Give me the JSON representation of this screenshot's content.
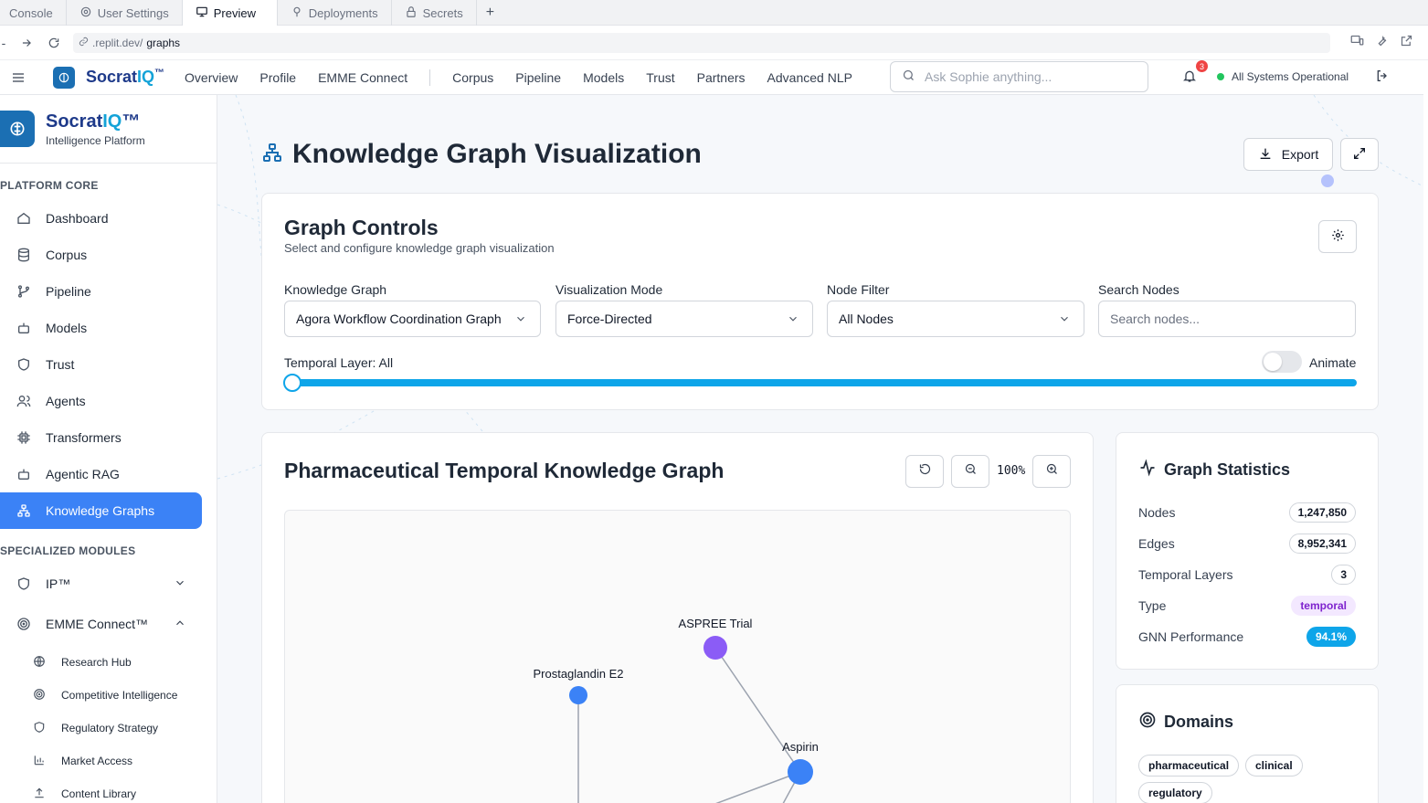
{
  "browser": {
    "tabs": [
      {
        "label": "Console"
      },
      {
        "label": "User Settings"
      },
      {
        "label": "Preview"
      },
      {
        "label": "Deployments"
      },
      {
        "label": "Secrets"
      }
    ],
    "add_tab": "+",
    "url_prefix": ".replit.dev/",
    "url_path": "graphs"
  },
  "header": {
    "brand": "SocratIQ",
    "brand_prefix": "Socrat",
    "brand_highlight": "IQ",
    "brand_tm": "™",
    "nav": [
      "Overview",
      "Profile",
      "EMME Connect",
      "Corpus",
      "Pipeline",
      "Models",
      "Trust",
      "Partners",
      "Advanced NLP"
    ],
    "search_placeholder": "Ask Sophie anything...",
    "notification_count": "3",
    "status": "All Systems Operational"
  },
  "sidebar": {
    "brand_prefix": "Socrat",
    "brand_highlight": "IQ",
    "brand_tm": "™",
    "subtitle": "Intelligence Platform",
    "section_core": "PLATFORM CORE",
    "core_items": [
      {
        "label": "Dashboard",
        "icon": "home-icon"
      },
      {
        "label": "Corpus",
        "icon": "database-icon"
      },
      {
        "label": "Pipeline",
        "icon": "git-branch-icon"
      },
      {
        "label": "Models",
        "icon": "bot-icon"
      },
      {
        "label": "Trust",
        "icon": "shield-icon"
      },
      {
        "label": "Agents",
        "icon": "users-icon"
      },
      {
        "label": "Transformers",
        "icon": "cpu-icon"
      },
      {
        "label": "Agentic RAG",
        "icon": "bot-icon"
      },
      {
        "label": "Knowledge Graphs",
        "icon": "network-icon",
        "active": true
      }
    ],
    "section_modules": "SPECIALIZED MODULES",
    "module_items": [
      {
        "label": "IP™",
        "icon": "shield-icon"
      },
      {
        "label": "EMME Connect™",
        "icon": "target-icon"
      }
    ],
    "emme_sub": [
      {
        "label": "Research Hub",
        "icon": "globe-icon"
      },
      {
        "label": "Competitive Intelligence",
        "icon": "target-icon"
      },
      {
        "label": "Regulatory Strategy",
        "icon": "shield-icon"
      },
      {
        "label": "Market Access",
        "icon": "bar-chart-icon"
      },
      {
        "label": "Content Library",
        "icon": "upload-icon"
      }
    ]
  },
  "page": {
    "title": "Knowledge Graph Visualization",
    "export_label": "Export"
  },
  "controls": {
    "title": "Graph Controls",
    "subtitle": "Select and configure knowledge graph visualization",
    "knowledge_graph_label": "Knowledge Graph",
    "knowledge_graph_value": "Agora Workflow Coordination Graph",
    "viz_mode_label": "Visualization Mode",
    "viz_mode_value": "Force-Directed",
    "node_filter_label": "Node Filter",
    "node_filter_value": "All Nodes",
    "search_label": "Search Nodes",
    "search_placeholder": "Search nodes...",
    "temporal_label": "Temporal Layer: All",
    "temporal_level": 0,
    "animate_label": "Animate",
    "animate_on": false
  },
  "graph": {
    "title": "Pharmaceutical Temporal Knowledge Graph",
    "zoom": "100%",
    "nodes": [
      {
        "label": "ASPREE Trial",
        "color": "#8b5cf6"
      },
      {
        "label": "Prostaglandin E2",
        "color": "#3b82f6"
      },
      {
        "label": "Aspirin",
        "color": "#3b82f6"
      }
    ]
  },
  "stats": {
    "title": "Graph Statistics",
    "rows": [
      {
        "label": "Nodes",
        "value": "1,247,850"
      },
      {
        "label": "Edges",
        "value": "8,952,341"
      },
      {
        "label": "Temporal Layers",
        "value": "3"
      },
      {
        "label": "Type",
        "value": "temporal"
      },
      {
        "label": "GNN Performance",
        "value": "94.1%"
      }
    ]
  },
  "domains": {
    "title": "Domains",
    "tags": [
      "pharmaceutical",
      "clinical",
      "regulatory"
    ]
  },
  "colors": {
    "accent": "#3b82f6",
    "brand": "#1b6fb3",
    "slider": "#0ea5e9",
    "purple_node": "#8b5cf6"
  }
}
